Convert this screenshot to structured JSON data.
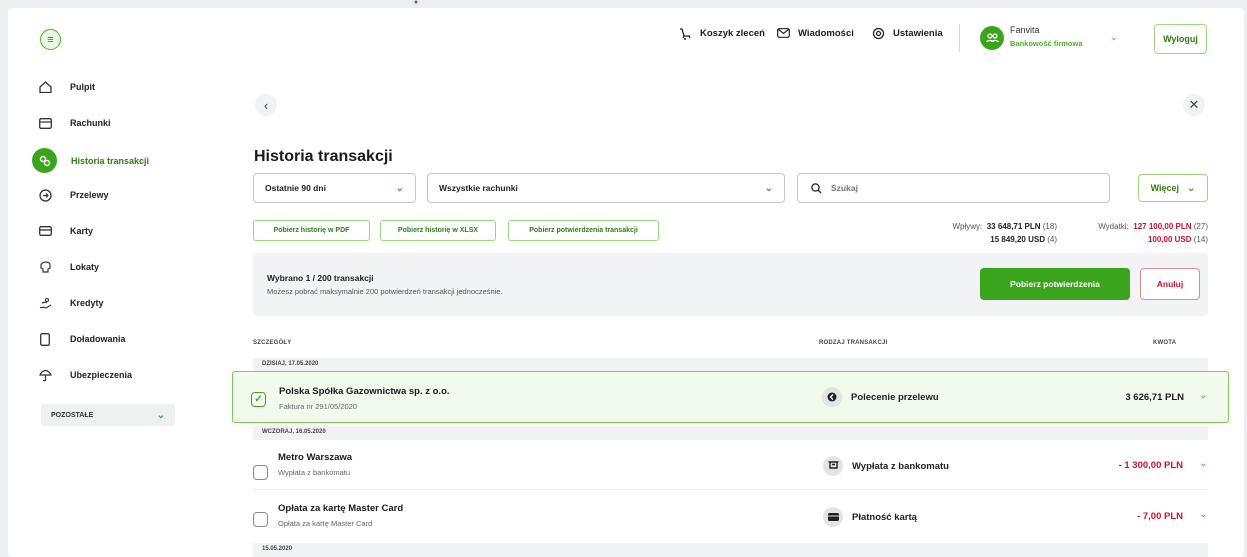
{
  "topbar": {
    "menu_icon": "menu-icon",
    "cart_label": "Koszyk zleceń",
    "messages_label": "Wiadomości",
    "settings_label": "Ustawienia",
    "user_name": "Fanvita",
    "user_sub": "Bankowość firmowa",
    "logout_label": "Wyloguj"
  },
  "sidebar": {
    "items": [
      {
        "label": "Pulpit",
        "icon": "home-icon"
      },
      {
        "label": "Rachunki",
        "icon": "wallet-icon"
      },
      {
        "label": "Historia transakcji",
        "icon": "history-icon"
      },
      {
        "label": "Przelewy",
        "icon": "transfer-icon"
      },
      {
        "label": "Karty",
        "icon": "card-icon"
      },
      {
        "label": "Lokaty",
        "icon": "deposit-icon"
      },
      {
        "label": "Kredyty",
        "icon": "loan-icon"
      },
      {
        "label": "Doładowania",
        "icon": "phone-icon"
      },
      {
        "label": "Ubezpieczenia",
        "icon": "umbrella-icon"
      }
    ],
    "active_index": 2,
    "other_label": "POZOSTAŁE"
  },
  "main": {
    "title": "Historia transakcji",
    "period_value": "Ostatnie 90 dni",
    "accounts_value": "Wszystkie rachunki",
    "search_placeholder": "Szukaj",
    "more_label": "Więcej",
    "download_pdf": "Pobierz historię w PDF",
    "download_xlsx": "Pobierz historię w XLSX",
    "download_confirmations": "Pobierz potwierdzenia transakcji",
    "inflows_label": "Wpływy:",
    "inflows_pln": "33 648,71 PLN",
    "inflows_pln_count": "(18)",
    "inflows_usd": "15 849,20 USD",
    "inflows_usd_count": "(4)",
    "outflows_label": "Wydatki:",
    "outflows_pln": "127 100,00 PLN",
    "outflows_pln_count": "(27)",
    "outflows_usd": "100,00 USD",
    "outflows_usd_count": "(14)",
    "selection_title": "Wybrano 1 / 200 transakcji",
    "selection_info": "Możesz pobrać maksymalnie 200 potwierdzeń transakcji jednocześnie.",
    "confirm_btn": "Pobierz potwierdzenia",
    "cancel_btn": "Anuluj",
    "col_details": "SZCZEGÓŁY",
    "col_type": "RODZAJ TRANSAKCJI",
    "col_amount": "KWOTA",
    "groups": [
      "DZISIAJ, 17.05.2020",
      "WCZORAJ, 16.05.2020",
      "15.05.2020"
    ],
    "rows": [
      {
        "title": "Polska Spółka Gazownictwa sp. z o.o.",
        "sub": "Faktura nr 291/05/2020",
        "type": "Polecenie przelewu",
        "type_icon": "transfer-icon",
        "amount": "3 626,71 PLN",
        "selected": true
      },
      {
        "title": "Metro Warszawa",
        "sub": "Wypłata z bankomatu",
        "type": "Wypłata z bankomatu",
        "type_icon": "atm-icon",
        "amount": "- 1 300,00 PLN",
        "selected": false
      },
      {
        "title": "Opłata za kartę Master Card",
        "sub": "Opłata za kartę Master Card",
        "type": "Płatność kartą",
        "type_icon": "card-icon",
        "amount": "- 7,00 PLN",
        "selected": false
      }
    ]
  },
  "colors": {
    "accent": "#3ba41d",
    "negative": "#c8102e",
    "selected_bg": "#f1faec"
  }
}
